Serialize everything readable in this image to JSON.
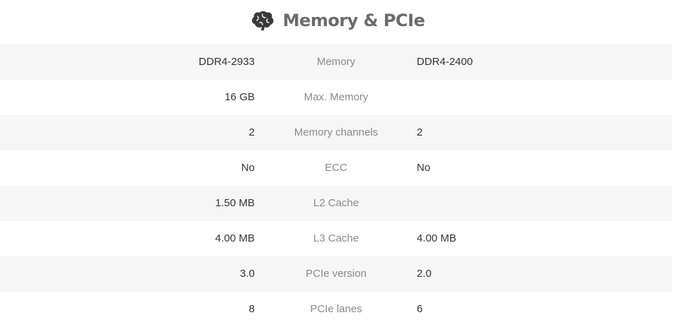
{
  "section": {
    "icon": "brain-icon",
    "title": "Memory & PCIe"
  },
  "rows": [
    {
      "label": "Memory",
      "left": "DDR4-2933",
      "right": "DDR4-2400"
    },
    {
      "label": "Max. Memory",
      "left": "16 GB",
      "right": ""
    },
    {
      "label": "Memory channels",
      "left": "2",
      "right": "2"
    },
    {
      "label": "ECC",
      "left": "No",
      "right": "No"
    },
    {
      "label": "L2 Cache",
      "left": "1.50 MB",
      "right": ""
    },
    {
      "label": "L3 Cache",
      "left": "4.00 MB",
      "right": "4.00 MB"
    },
    {
      "label": "PCIe version",
      "left": "3.0",
      "right": "2.0"
    },
    {
      "label": "PCIe lanes",
      "left": "8",
      "right": "6"
    }
  ]
}
